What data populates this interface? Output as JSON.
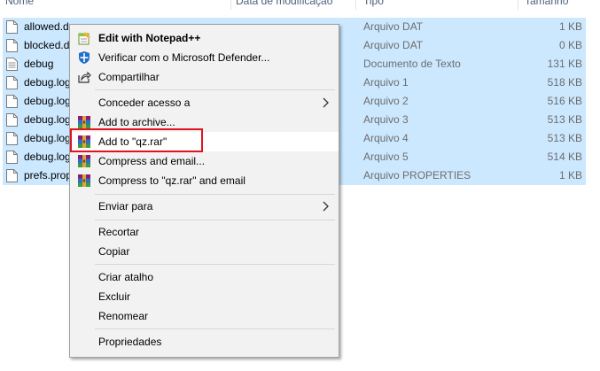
{
  "columns": {
    "name": "Nome",
    "modified": "Data de modificação",
    "type": "Tipo",
    "size": "Tamanho"
  },
  "files": [
    {
      "name": "allowed.dat",
      "type": "Arquivo DAT",
      "size": "1 KB",
      "icon": "file-icon"
    },
    {
      "name": "blocked.dat",
      "type": "Arquivo DAT",
      "size": "0 KB",
      "icon": "file-icon"
    },
    {
      "name": "debug",
      "type": "Documento de Texto",
      "size": "131 KB",
      "icon": "text-file-icon"
    },
    {
      "name": "debug.log.1",
      "type": "Arquivo 1",
      "size": "518 KB",
      "icon": "file-icon"
    },
    {
      "name": "debug.log.2",
      "type": "Arquivo 2",
      "size": "516 KB",
      "icon": "file-icon"
    },
    {
      "name": "debug.log.3",
      "type": "Arquivo 3",
      "size": "513 KB",
      "icon": "file-icon"
    },
    {
      "name": "debug.log.4",
      "type": "Arquivo 4",
      "size": "513 KB",
      "icon": "file-icon"
    },
    {
      "name": "debug.log.5",
      "type": "Arquivo 5",
      "size": "514 KB",
      "icon": "file-icon"
    },
    {
      "name": "prefs.properties",
      "type": "Arquivo PROPERTIES",
      "size": "1 KB",
      "icon": "file-icon"
    }
  ],
  "menu": {
    "edit_notepad": "Edit with Notepad++",
    "defender": "Verificar com o Microsoft Defender...",
    "share": "Compartilhar",
    "grant_access": "Conceder acesso a",
    "add_archive": "Add to archive...",
    "add_qz": "Add to \"qz.rar\"",
    "compress_email": "Compress and email...",
    "compress_qz_email": "Compress to \"qz.rar\" and email",
    "send_to": "Enviar para",
    "cut": "Recortar",
    "copy": "Copiar",
    "create_shortcut": "Criar atalho",
    "delete": "Excluir",
    "rename": "Renomear",
    "properties": "Propriedades"
  },
  "colors": {
    "selection": "#cce8ff",
    "menu_bg": "#f2f2f2",
    "highlight_box": "#e0141e"
  }
}
